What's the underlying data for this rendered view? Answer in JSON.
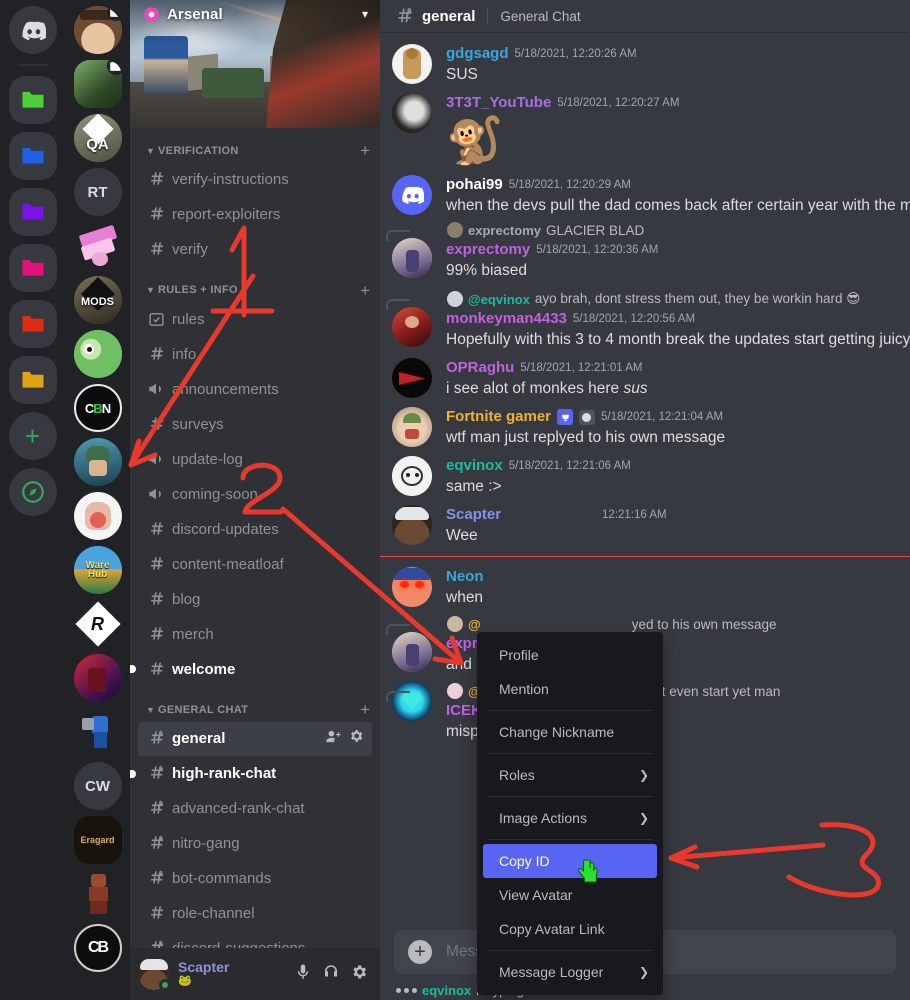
{
  "app": {
    "name": "Discord",
    "accent": "#5865f2",
    "annotation_color": "#e8392c"
  },
  "server_rail": {
    "home_label": "Discord Home",
    "folders": [
      {
        "name": "folder-green",
        "color": "#4cd137"
      },
      {
        "name": "folder-blue",
        "color": "#1f5fe0"
      },
      {
        "name": "folder-purple",
        "color": "#7d12e8"
      },
      {
        "name": "folder-pink",
        "color": "#e0127a"
      },
      {
        "name": "folder-red",
        "color": "#e02a12"
      },
      {
        "name": "folder-yellow",
        "color": "#e0a112"
      }
    ],
    "add_server_label": "+",
    "explore_label": "Explore Public Servers",
    "guilds": [
      {
        "label": "",
        "kind": "image",
        "tint": "#8b6a55",
        "badge": "screen"
      },
      {
        "label": "",
        "kind": "image",
        "tint": "#3f6b35",
        "badge": "screen"
      },
      {
        "label": "QA",
        "kind": "text-image",
        "tint": "#6b6b5a"
      },
      {
        "label": "RT",
        "kind": "text",
        "tint": "#36393f"
      },
      {
        "label": "",
        "kind": "image",
        "tint": "#e8a0d8"
      },
      {
        "label": "MODS",
        "kind": "text-image",
        "tint": "#5b5244"
      },
      {
        "label": "",
        "kind": "image",
        "tint": "#7bc96f"
      },
      {
        "label": "CBN",
        "kind": "text-image",
        "tint": "#111111"
      },
      {
        "label": "",
        "kind": "image",
        "tint": "#2f6f86",
        "selected": true
      },
      {
        "label": "",
        "kind": "image",
        "tint": "#f2f2f2"
      },
      {
        "label": "WareHub",
        "kind": "text-image",
        "tint": "#2d7fc0"
      },
      {
        "label": "R",
        "kind": "text-image",
        "tint": "#1a1a1a"
      },
      {
        "label": "",
        "kind": "image",
        "tint": "#8b1020"
      },
      {
        "label": "",
        "kind": "image",
        "tint": "#2a2a2a"
      },
      {
        "label": "CW",
        "kind": "text",
        "tint": "#36393f"
      },
      {
        "label": "Eragard",
        "kind": "text-image",
        "tint": "#17130c"
      },
      {
        "label": "",
        "kind": "image",
        "tint": "#7a3b28"
      },
      {
        "label": "CB",
        "kind": "text-image",
        "tint": "#0d0d0d"
      }
    ]
  },
  "sidebar": {
    "guild_name": "Arsenal",
    "guild_dropdown_icon": "chevron-down-icon",
    "categories": [
      {
        "name": "VERIFICATION",
        "add_label": "+",
        "channels": [
          {
            "name": "verify-instructions",
            "icon": "hash-icon",
            "state": "read"
          },
          {
            "name": "report-exploiters",
            "icon": "hash-icon",
            "state": "read"
          },
          {
            "name": "verify",
            "icon": "hash-icon",
            "state": "read"
          }
        ]
      },
      {
        "name": "RULES + INFO",
        "add_label": "+",
        "channels": [
          {
            "name": "rules",
            "icon": "rules-icon",
            "state": "read"
          },
          {
            "name": "info",
            "icon": "hash-icon",
            "state": "read"
          },
          {
            "name": "announcements",
            "icon": "announcement-icon",
            "state": "read"
          },
          {
            "name": "surveys",
            "icon": "hash-icon",
            "state": "read"
          },
          {
            "name": "update-log",
            "icon": "announcement-icon",
            "state": "read"
          },
          {
            "name": "coming-soon",
            "icon": "announcement-icon",
            "state": "read"
          },
          {
            "name": "discord-updates",
            "icon": "hash-icon",
            "state": "read"
          },
          {
            "name": "content-meatloaf",
            "icon": "hash-icon",
            "state": "read"
          },
          {
            "name": "blog",
            "icon": "hash-icon",
            "state": "read"
          },
          {
            "name": "merch",
            "icon": "hash-icon",
            "state": "read"
          },
          {
            "name": "welcome",
            "icon": "hash-icon",
            "state": "unread"
          }
        ]
      },
      {
        "name": "GENERAL CHAT",
        "add_label": "+",
        "channels": [
          {
            "name": "general",
            "icon": "hash-lock-icon",
            "state": "active"
          },
          {
            "name": "high-rank-chat",
            "icon": "hash-lock-icon",
            "state": "unread"
          },
          {
            "name": "advanced-rank-chat",
            "icon": "hash-lock-icon",
            "state": "read"
          },
          {
            "name": "nitro-gang",
            "icon": "hash-lock-icon",
            "state": "read"
          },
          {
            "name": "bot-commands",
            "icon": "hash-lock-icon",
            "state": "read"
          },
          {
            "name": "role-channel",
            "icon": "hash-icon",
            "state": "read"
          },
          {
            "name": "discord-suggestions",
            "icon": "hash-lock-icon",
            "state": "read"
          }
        ]
      }
    ],
    "active_channel_actions": [
      "add-member-icon",
      "channel-settings-icon"
    ],
    "user_panel": {
      "username": "Scapter",
      "status": "online",
      "custom_status_emoji": "🐸",
      "controls": [
        "mute-icon",
        "deafen-icon",
        "user-settings-icon"
      ]
    }
  },
  "chat_header": {
    "channel_icon": "hash-lock-icon",
    "channel_name": "general",
    "topic": "General Chat"
  },
  "messages": [
    {
      "author": "gdgsagd",
      "author_color": "#3aa6e0",
      "timestamp": "5/18/2021, 12:20:26 AM",
      "text": "SUS",
      "avatar_tint": "#f0f0f0"
    },
    {
      "author": "3T3T_YouTube",
      "author_color": "#a86fe0",
      "timestamp": "5/18/2021, 12:20:27 AM",
      "text": "🐒",
      "big_emoji": true,
      "avatar_tint": "#d8d8d8"
    },
    {
      "author": "pohai99",
      "author_color": "#ffffff",
      "timestamp": "5/18/2021, 12:20:29 AM",
      "text": "when the devs  pull the dad comes back after certain year with the milk",
      "avatar_tint": "#5865f2"
    },
    {
      "author": "exprectomy",
      "author_color": "#c062e0",
      "timestamp": "5/18/2021, 12:20:36 AM",
      "text": "99% biased",
      "avatar_tint": "#c9b8a8",
      "reply": {
        "author": "exprectomy",
        "author_color": "#a6a9ad",
        "text": "GLACIER BLAD"
      }
    },
    {
      "author": "monkeyman4433",
      "author_color": "#c062e0",
      "timestamp": "5/18/2021, 12:20:56 AM",
      "text": "Hopefully with this 3 to 4 month break the updates start getting juicy i",
      "avatar_tint": "#b02a2a",
      "reply": {
        "author": "@eqvinox",
        "author_color": "#1abc9c",
        "text": "ayo brah, dont stress them out, they be workin hard 😎"
      }
    },
    {
      "author": "OPRaghu",
      "author_color": "#c062e0",
      "timestamp": "5/18/2021, 12:21:01 AM",
      "text": "i see alot of monkes here sus",
      "italic_tail": "sus",
      "avatar_tint": "#000000"
    },
    {
      "author": "Fortnite gamer",
      "author_color": "#f0b232",
      "timestamp": "5/18/2021, 12:21:04 AM",
      "text": "wtf man just replyed to his own message",
      "avatar_tint": "#cbb7a0",
      "badges": [
        "crown-badge",
        "bot-tag-badge"
      ]
    },
    {
      "author": "eqvinox",
      "author_color": "#1abc9c",
      "timestamp": "5/18/2021, 12:21:06 AM",
      "text": "same :>",
      "avatar_tint": "#e6e6e6"
    },
    {
      "author": "Scapter",
      "author_color": "#8a8fe0",
      "timestamp": "12:21:16 AM",
      "text": "Wee",
      "avatar_tint": "#4a3326",
      "truncated_by_menu": true
    },
    {
      "author": "Neon",
      "author_color": "#3aa6e0",
      "timestamp": "",
      "text": "when",
      "avatar_tint": "#e8725a",
      "truncated_by_menu": true
    },
    {
      "author": "exprectomy",
      "author_color": "#c062e0",
      "timestamp": "",
      "text": "and",
      "avatar_tint": "#c9b8a8",
      "truncated_by_menu": true,
      "reply": {
        "author": "@",
        "author_color": "#f0b232",
        "text": "yed to his own message"
      }
    },
    {
      "author": "ICEK",
      "author_color": "#c062e0",
      "timestamp": "M",
      "text": "misp",
      "avatar_tint": "#1a8ad4",
      "truncated_by_menu": true,
      "reply": {
        "author": "@",
        "author_color": "#f0b232",
        "text": "didn't even start yet man"
      }
    }
  ],
  "new_messages_divider": {
    "visible": true,
    "color": "#f04747"
  },
  "composer": {
    "add_icon": "plus-circle-icon",
    "placeholder": "Message #general"
  },
  "typing_indicator": {
    "user": "eqvinox",
    "text": "is typing..."
  },
  "context_menu": {
    "items": [
      {
        "label": "Profile",
        "submenu": false,
        "highlighted": false
      },
      {
        "label": "Mention",
        "submenu": false,
        "highlighted": false
      },
      {
        "separator_after": true
      },
      {
        "label": "Change Nickname",
        "submenu": false,
        "highlighted": false
      },
      {
        "separator_after": true
      },
      {
        "label": "Roles",
        "submenu": true,
        "highlighted": false
      },
      {
        "separator_after": true
      },
      {
        "label": "Image Actions",
        "submenu": true,
        "highlighted": false
      },
      {
        "separator_after": true
      },
      {
        "label": "Copy ID",
        "submenu": false,
        "highlighted": true
      },
      {
        "label": "View Avatar",
        "submenu": false,
        "highlighted": false
      },
      {
        "label": "Copy Avatar Link",
        "submenu": false,
        "highlighted": false
      },
      {
        "separator_after": true
      },
      {
        "label": "Message Logger",
        "submenu": true,
        "highlighted": false
      }
    ]
  },
  "annotations": {
    "color": "#e8392c",
    "marks": [
      {
        "name": "step-1-numeral",
        "label": "1"
      },
      {
        "name": "step-1-arrow",
        "label": "arrow to channel list"
      },
      {
        "name": "step-2-numeral",
        "label": "2"
      },
      {
        "name": "step-2-arrow",
        "label": "arrow to username"
      },
      {
        "name": "step-3-numeral",
        "label": "3"
      },
      {
        "name": "step-3-arrow",
        "label": "arrow to Copy ID"
      }
    ]
  }
}
